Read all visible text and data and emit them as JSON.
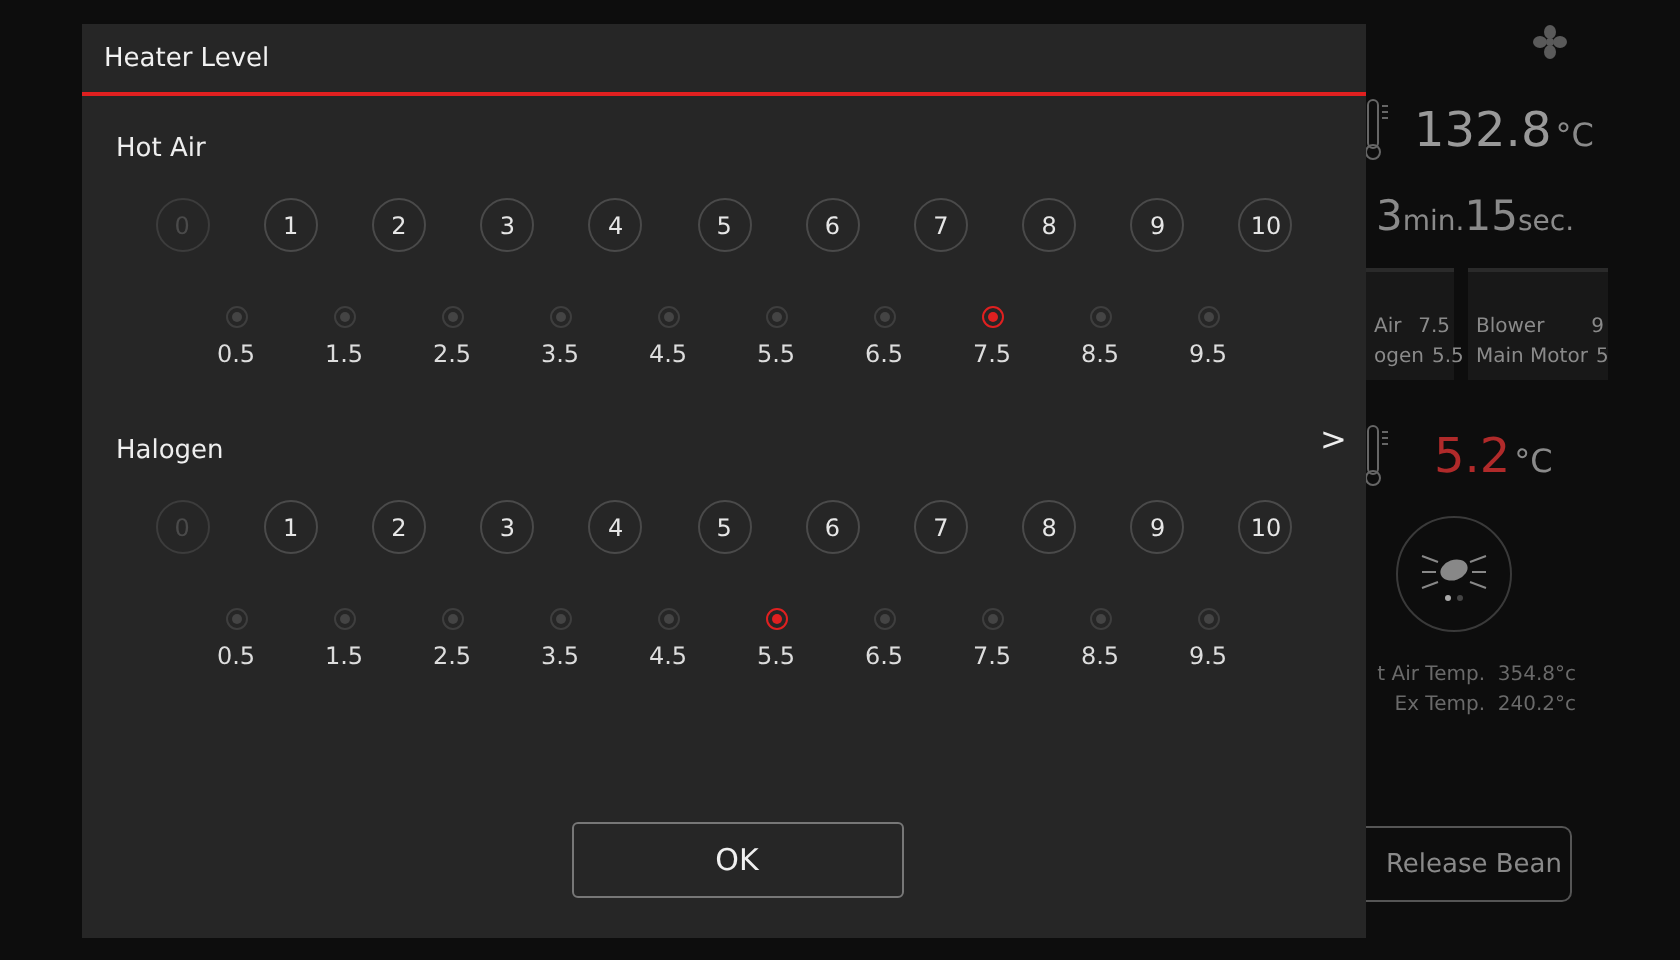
{
  "dialog": {
    "title": "Heater Level",
    "heaters": [
      {
        "name": "Hot Air",
        "levels": [
          {
            "label": "0",
            "disabled": true
          },
          {
            "label": "1",
            "disabled": false
          },
          {
            "label": "2",
            "disabled": false
          },
          {
            "label": "3",
            "disabled": false
          },
          {
            "label": "4",
            "disabled": false
          },
          {
            "label": "5",
            "disabled": false
          },
          {
            "label": "6",
            "disabled": false
          },
          {
            "label": "7",
            "disabled": false
          },
          {
            "label": "8",
            "disabled": false
          },
          {
            "label": "9",
            "disabled": false
          },
          {
            "label": "10",
            "disabled": false
          }
        ],
        "half_steps": [
          {
            "label": "0.5",
            "selected": false
          },
          {
            "label": "1.5",
            "selected": false
          },
          {
            "label": "2.5",
            "selected": false
          },
          {
            "label": "3.5",
            "selected": false
          },
          {
            "label": "4.5",
            "selected": false
          },
          {
            "label": "5.5",
            "selected": false
          },
          {
            "label": "6.5",
            "selected": false
          },
          {
            "label": "7.5",
            "selected": true
          },
          {
            "label": "8.5",
            "selected": false
          },
          {
            "label": "9.5",
            "selected": false
          }
        ]
      },
      {
        "name": "Halogen",
        "levels": [
          {
            "label": "0",
            "disabled": true
          },
          {
            "label": "1",
            "disabled": false
          },
          {
            "label": "2",
            "disabled": false
          },
          {
            "label": "3",
            "disabled": false
          },
          {
            "label": "4",
            "disabled": false
          },
          {
            "label": "5",
            "disabled": false
          },
          {
            "label": "6",
            "disabled": false
          },
          {
            "label": "7",
            "disabled": false
          },
          {
            "label": "8",
            "disabled": false
          },
          {
            "label": "9",
            "disabled": false
          },
          {
            "label": "10",
            "disabled": false
          }
        ],
        "half_steps": [
          {
            "label": "0.5",
            "selected": false
          },
          {
            "label": "1.5",
            "selected": false
          },
          {
            "label": "2.5",
            "selected": false
          },
          {
            "label": "3.5",
            "selected": false
          },
          {
            "label": "4.5",
            "selected": false
          },
          {
            "label": "5.5",
            "selected": true
          },
          {
            "label": "6.5",
            "selected": false
          },
          {
            "label": "7.5",
            "selected": false
          },
          {
            "label": "8.5",
            "selected": false
          },
          {
            "label": "9.5",
            "selected": false
          }
        ]
      }
    ],
    "next": ">",
    "ok": "OK"
  },
  "panel": {
    "bean_temp": {
      "value": "132.8",
      "unit": "°C"
    },
    "time": {
      "minutes": "3",
      "min_unit": "min.",
      "seconds": "15",
      "sec_unit": "sec."
    },
    "cards": [
      {
        "rows": [
          {
            "label": "Air",
            "value": "7.5"
          },
          {
            "label": "ogen",
            "value": "5.5"
          }
        ]
      },
      {
        "rows": [
          {
            "label": "Blower",
            "value": "9"
          },
          {
            "label": "Main Motor",
            "value": "5"
          }
        ]
      }
    ],
    "rate": {
      "value": "5.2",
      "unit": "°C"
    },
    "temps": [
      {
        "label": "t Air Temp.",
        "value": "354.8°c"
      },
      {
        "label": "Ex Temp.",
        "value": "240.2°c"
      }
    ],
    "release": "Release Bean"
  }
}
